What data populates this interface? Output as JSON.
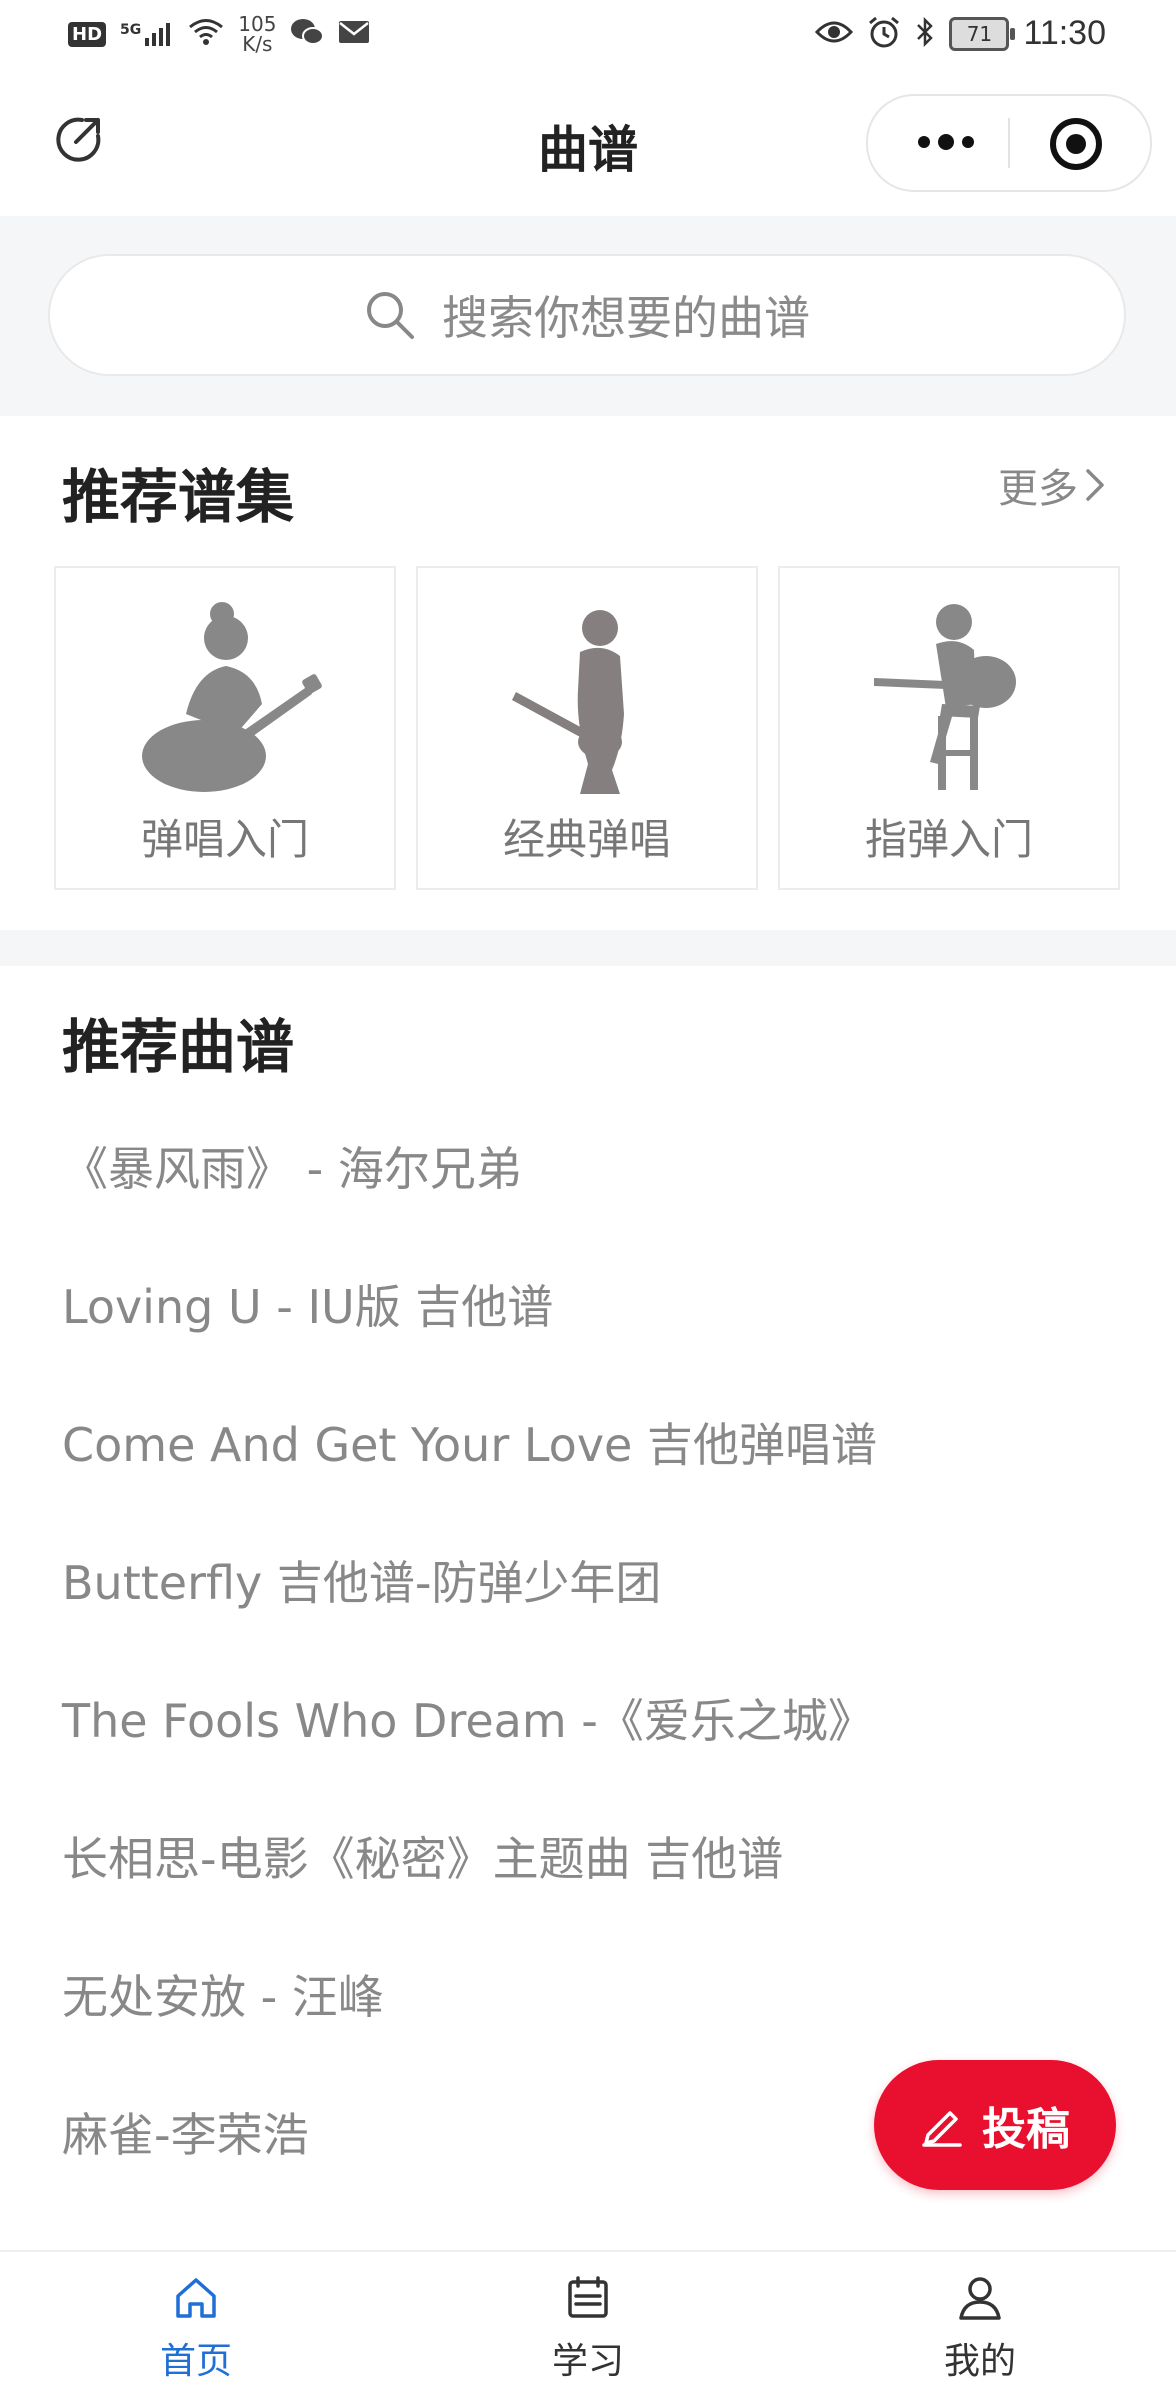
{
  "status_bar": {
    "hd_badge": "HD",
    "signal": "5G",
    "net_speed_value": "105",
    "net_speed_unit": "K/s",
    "battery": "71",
    "time": "11:30"
  },
  "header": {
    "title": "曲谱",
    "icons": [
      "share-icon",
      "more-icon",
      "target-icon"
    ]
  },
  "search": {
    "placeholder": "搜索你想要的曲谱"
  },
  "collections": {
    "title": "推荐谱集",
    "more_label": "更多",
    "items": [
      {
        "label": "弹唱入门"
      },
      {
        "label": "经典弹唱"
      },
      {
        "label": "指弹入门"
      }
    ]
  },
  "songs": {
    "title": "推荐曲谱",
    "items": [
      "《暴风雨》 - 海尔兄弟",
      "Loving U - IU版 吉他谱",
      "Come And Get Your Love 吉他弹唱谱",
      "Butterfly 吉他谱-防弹少年团",
      "The Fools Who Dream -《爱乐之城》",
      "长相思-电影《秘密》主题曲 吉他谱",
      "无处安放 - 汪峰",
      "麻雀-李荣浩"
    ]
  },
  "fab": {
    "label": "投稿",
    "color": "#e8102e"
  },
  "tab_bar": {
    "active_color": "#1f6fd6",
    "items": [
      {
        "label": "首页",
        "icon": "home-icon",
        "active": true
      },
      {
        "label": "学习",
        "icon": "study-icon",
        "active": false
      },
      {
        "label": "我的",
        "icon": "user-icon",
        "active": false
      }
    ]
  }
}
